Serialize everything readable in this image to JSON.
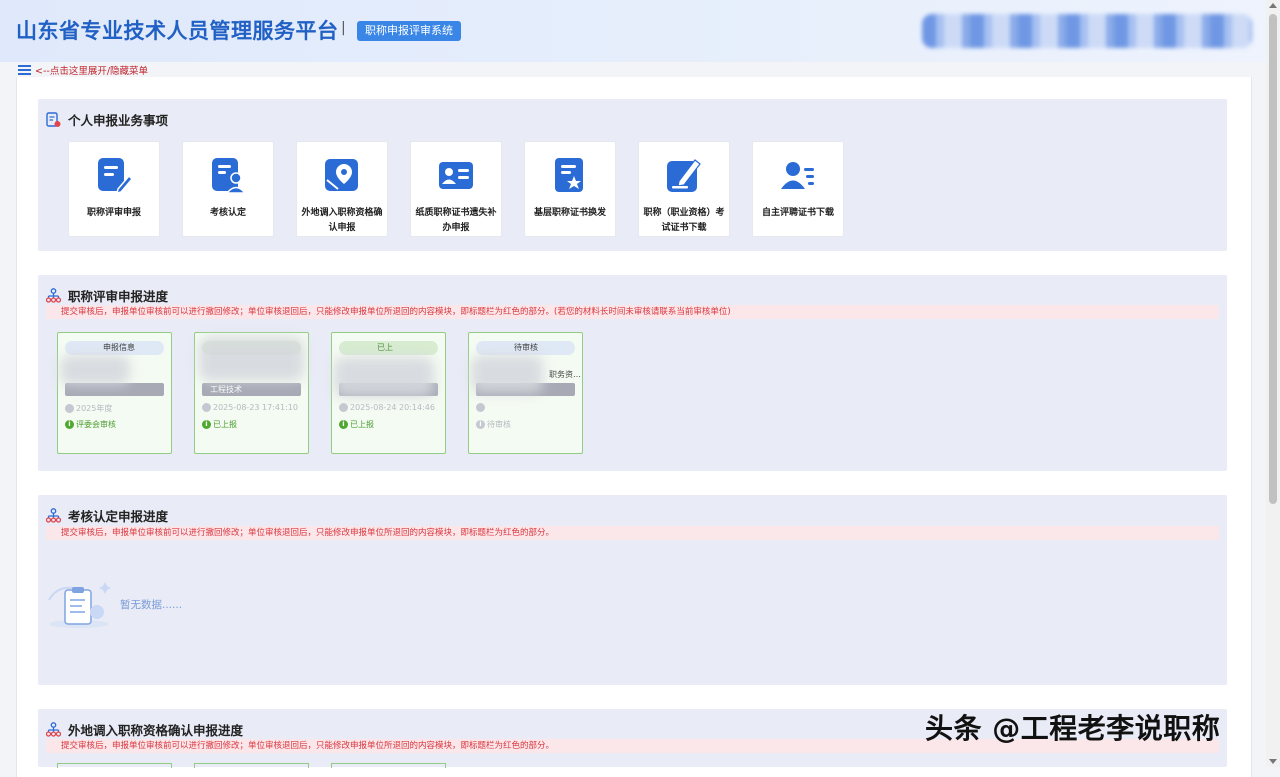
{
  "header": {
    "title": "山东省专业技术人员管理服务平台",
    "separator": "|",
    "system_badge": "职称申报评审系统"
  },
  "menu_toggle": {
    "label": "<--点击这里展开/隐藏菜单"
  },
  "services_section": {
    "title": "个人申报业务事项",
    "tiles": [
      {
        "label": "职称评审申报",
        "icon": "edit-document-icon"
      },
      {
        "label": "考核认定",
        "icon": "user-document-icon"
      },
      {
        "label": "外地调入职称资格确认申报",
        "icon": "map-pin-icon"
      },
      {
        "label": "纸质职称证书遗失补办申报",
        "icon": "id-card-icon"
      },
      {
        "label": "基层职称证书换发",
        "icon": "star-document-icon"
      },
      {
        "label": "职称（职业资格）考试证书下载",
        "icon": "pen-square-icon"
      },
      {
        "label": "自主评聘证书下载",
        "icon": "user-list-icon"
      }
    ],
    "icon_color": "#2a6bd6"
  },
  "evaluation_progress": {
    "title": "职称评审申报进度",
    "notice": "提交审核后，申报单位审核前可以进行撤回修改；单位审核退回后，只能修改申报单位所退回的内容模块，即标题栏为红色的部分。(若您的材料长时间未审核请联系当前审核单位)",
    "cards": [
      {
        "pill": "申报信息",
        "grey_label": "",
        "time": "2025年度",
        "status": "评委会审核"
      },
      {
        "pill": "",
        "grey_label": "工程技术",
        "time": "2025-08-23 17:41:10",
        "status": "已上报"
      },
      {
        "pill": "已上",
        "grey_label": "",
        "time": "2025-08-24 20:14:46",
        "status": "已上报"
      },
      {
        "pill": "待审核",
        "mid_text": "职务资…",
        "grey_label": "",
        "time": "",
        "status": "待审核"
      }
    ]
  },
  "assessment_progress": {
    "title": "考核认定申报进度",
    "notice": "提交审核后，申报单位审核前可以进行撤回修改；单位审核退回后，只能修改申报单位所退回的内容模块，即标题栏为红色的部分。",
    "empty_text": "暂无数据......"
  },
  "transfer_progress": {
    "title": "外地调入职称资格确认申报进度",
    "notice": "提交审核后，申报单位审核前可以进行撤回修改；单位审核退回后，只能修改申报单位所退回的内容模块，即标题栏为红色的部分。"
  },
  "watermark": "头条 @工程老李说职称",
  "colors": {
    "accent": "#2a6bd6",
    "notice_red": "#d9363e",
    "card_green": "#93cc83",
    "section_bg": "#e9ecf6"
  }
}
